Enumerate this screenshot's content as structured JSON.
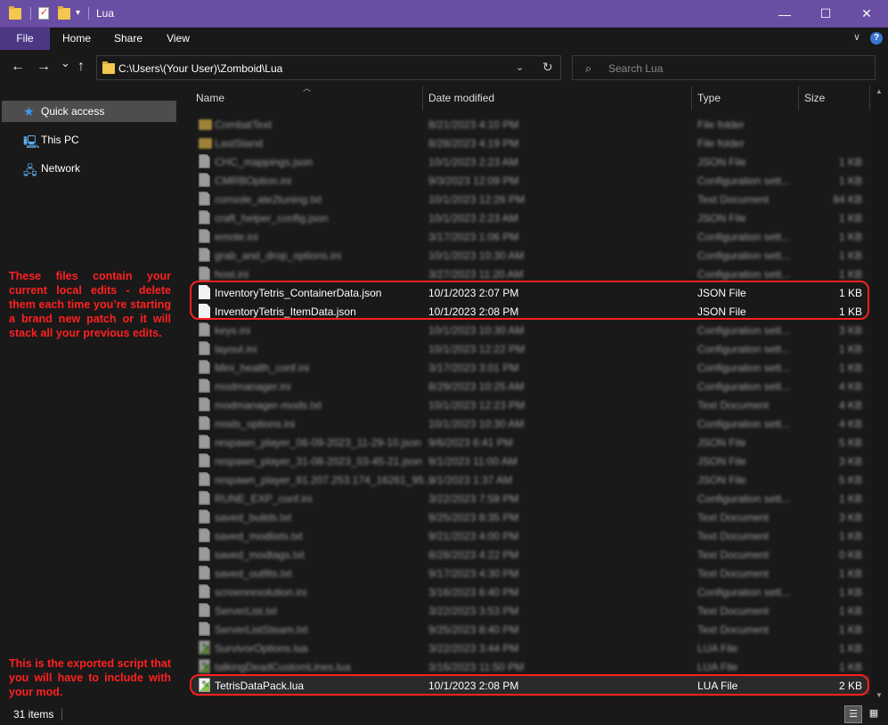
{
  "window": {
    "title": "Lua",
    "buttons": {
      "minimize": "—",
      "maximize": "☐",
      "close": "✕"
    }
  },
  "ribbon": {
    "tabs": [
      "File",
      "Home",
      "Share",
      "View"
    ],
    "expand": "∨",
    "help": "?"
  },
  "nav": {
    "back": "←",
    "forward": "→",
    "recent": "⌄",
    "up": "↑",
    "address": "C:\\Users\\(Your User)\\Zomboid\\Lua",
    "address_dropdown": "⌄",
    "refresh": "↻",
    "search_placeholder": "Search Lua"
  },
  "sidebar": {
    "items": [
      {
        "label": "Quick access",
        "icon": "star-icon"
      },
      {
        "label": "This PC",
        "icon": "computer-icon"
      },
      {
        "label": "Network",
        "icon": "network-icon"
      }
    ],
    "annotation_top": "These files contain your current local edits - delete them each time you’re starting a brand new patch or it will stack all your previous edits.",
    "annotation_bottom": "This is the exported script that you will have to include with your mod."
  },
  "columns": {
    "name": "Name",
    "date": "Date modified",
    "type": "Type",
    "size": "Size"
  },
  "files": [
    {
      "name": "CombatText",
      "date": "8/21/2023 4:10 PM",
      "type": "File folder",
      "size": "",
      "icon": "folder",
      "blur": true
    },
    {
      "name": "LastStand",
      "date": "8/28/2023 4:19 PM",
      "type": "File folder",
      "size": "",
      "icon": "folder",
      "blur": true
    },
    {
      "name": "CHC_mappings.json",
      "date": "10/1/2023 2:23 AM",
      "type": "JSON File",
      "size": "1 KB",
      "icon": "file",
      "blur": true
    },
    {
      "name": "CMRBOption.ini",
      "date": "9/3/2023 12:09 PM",
      "type": "Configuration sett...",
      "size": "1 KB",
      "icon": "file",
      "blur": true
    },
    {
      "name": "console_ate2tuning.txt",
      "date": "10/1/2023 12:26 PM",
      "type": "Text Document",
      "size": "84 KB",
      "icon": "file",
      "blur": true
    },
    {
      "name": "craft_helper_config.json",
      "date": "10/1/2023 2:23 AM",
      "type": "JSON File",
      "size": "1 KB",
      "icon": "file",
      "blur": true
    },
    {
      "name": "emote.ini",
      "date": "3/17/2023 1:06 PM",
      "type": "Configuration sett...",
      "size": "1 KB",
      "icon": "file",
      "blur": true
    },
    {
      "name": "grab_and_drop_options.ini",
      "date": "10/1/2023 10:30 AM",
      "type": "Configuration sett...",
      "size": "1 KB",
      "icon": "file",
      "blur": true
    },
    {
      "name": "host.ini",
      "date": "3/27/2023 11:20 AM",
      "type": "Configuration sett...",
      "size": "1 KB",
      "icon": "file",
      "blur": true
    },
    {
      "name": "InventoryTetris_ContainerData.json",
      "date": "10/1/2023 2:07 PM",
      "type": "JSON File",
      "size": "1 KB",
      "icon": "file",
      "blur": false
    },
    {
      "name": "InventoryTetris_ItemData.json",
      "date": "10/1/2023 2:08 PM",
      "type": "JSON File",
      "size": "1 KB",
      "icon": "file",
      "blur": false
    },
    {
      "name": "keys.ini",
      "date": "10/1/2023 10:30 AM",
      "type": "Configuration sett...",
      "size": "3 KB",
      "icon": "file",
      "blur": true
    },
    {
      "name": "layout.ini",
      "date": "10/1/2023 12:22 PM",
      "type": "Configuration sett...",
      "size": "1 KB",
      "icon": "file",
      "blur": true
    },
    {
      "name": "Mini_health_conf.ini",
      "date": "3/17/2023 3:01 PM",
      "type": "Configuration sett...",
      "size": "1 KB",
      "icon": "file",
      "blur": true
    },
    {
      "name": "modmanager.ini",
      "date": "8/29/2023 10:25 AM",
      "type": "Configuration sett...",
      "size": "4 KB",
      "icon": "file",
      "blur": true
    },
    {
      "name": "modmanager-mods.txt",
      "date": "10/1/2023 12:23 PM",
      "type": "Text Document",
      "size": "4 KB",
      "icon": "file",
      "blur": true
    },
    {
      "name": "mods_options.ini",
      "date": "10/1/2023 10:30 AM",
      "type": "Configuration sett...",
      "size": "4 KB",
      "icon": "file",
      "blur": true
    },
    {
      "name": "respawn_player_06-09-2023_11-29-10.json",
      "date": "9/6/2023 6:41 PM",
      "type": "JSON File",
      "size": "5 KB",
      "icon": "file",
      "blur": true
    },
    {
      "name": "respawn_player_31-08-2023_03-45-21.json",
      "date": "9/1/2023 11:00 AM",
      "type": "JSON File",
      "size": "3 KB",
      "icon": "file",
      "blur": true
    },
    {
      "name": "respawn_player_81.207.253.174_16261_95...",
      "date": "9/1/2023 1:37 AM",
      "type": "JSON File",
      "size": "5 KB",
      "icon": "file",
      "blur": true
    },
    {
      "name": "RUNE_EXP_conf.ini",
      "date": "3/22/2023 7:58 PM",
      "type": "Configuration sett...",
      "size": "1 KB",
      "icon": "file",
      "blur": true
    },
    {
      "name": "saved_builds.txt",
      "date": "9/25/2023 8:35 PM",
      "type": "Text Document",
      "size": "3 KB",
      "icon": "file",
      "blur": true
    },
    {
      "name": "saved_modlists.txt",
      "date": "9/21/2023 4:00 PM",
      "type": "Text Document",
      "size": "1 KB",
      "icon": "file",
      "blur": true
    },
    {
      "name": "saved_modtags.txt",
      "date": "8/28/2023 4:22 PM",
      "type": "Text Document",
      "size": "0 KB",
      "icon": "file",
      "blur": true
    },
    {
      "name": "saved_outfits.txt",
      "date": "9/17/2023 4:30 PM",
      "type": "Text Document",
      "size": "1 KB",
      "icon": "file",
      "blur": true
    },
    {
      "name": "screenresolution.ini",
      "date": "3/16/2023 6:40 PM",
      "type": "Configuration sett...",
      "size": "1 KB",
      "icon": "file",
      "blur": true
    },
    {
      "name": "ServerList.txt",
      "date": "3/22/2023 3:53 PM",
      "type": "Text Document",
      "size": "1 KB",
      "icon": "file",
      "blur": true
    },
    {
      "name": "ServerListSteam.txt",
      "date": "9/25/2023 8:40 PM",
      "type": "Text Document",
      "size": "1 KB",
      "icon": "file",
      "blur": true
    },
    {
      "name": "SurvivorOptions.lua",
      "date": "3/22/2023 3:44 PM",
      "type": "LUA File",
      "size": "1 KB",
      "icon": "lua",
      "blur": true
    },
    {
      "name": "talkingDeadCustomLines.lua",
      "date": "3/16/2023 11:50 PM",
      "type": "LUA File",
      "size": "1 KB",
      "icon": "lua",
      "blur": true
    },
    {
      "name": "TetrisDataPack.lua",
      "date": "10/1/2023 2:08 PM",
      "type": "LUA File",
      "size": "2 KB",
      "icon": "lua",
      "blur": false,
      "focused": true
    }
  ],
  "status": {
    "count": "31 items"
  },
  "colors": {
    "titlebar": "#6a4ea3",
    "file_tab": "#4c3785",
    "highlight": "#ff2020",
    "background": "#191919"
  }
}
